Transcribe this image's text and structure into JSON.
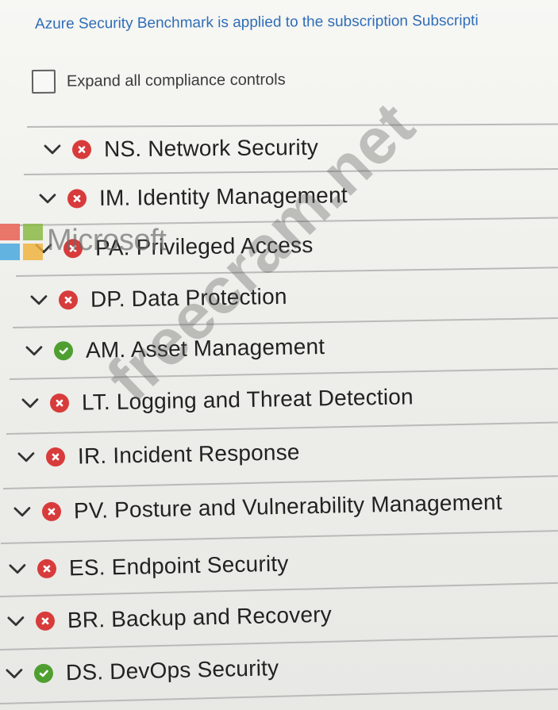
{
  "header": {
    "info_text": "Azure Security Benchmark is applied to the subscription Subscripti",
    "expand_label": "Expand all compliance controls"
  },
  "controls": [
    {
      "label": "NS. Network Security",
      "status": "failed",
      "status_icon": "error-circle-icon"
    },
    {
      "label": "IM. Identity Management",
      "status": "failed",
      "status_icon": "error-circle-icon"
    },
    {
      "label": "PA. Privileged Access",
      "status": "failed",
      "status_icon": "error-circle-icon"
    },
    {
      "label": "DP. Data Protection",
      "status": "failed",
      "status_icon": "error-circle-icon"
    },
    {
      "label": "AM. Asset Management",
      "status": "passed",
      "status_icon": "check-circle-icon"
    },
    {
      "label": "LT. Logging and Threat Detection",
      "status": "failed",
      "status_icon": "error-circle-icon"
    },
    {
      "label": "IR. Incident Response",
      "status": "failed",
      "status_icon": "error-circle-icon"
    },
    {
      "label": "PV. Posture and Vulnerability Management",
      "status": "failed",
      "status_icon": "error-circle-icon"
    },
    {
      "label": "ES. Endpoint Security",
      "status": "failed",
      "status_icon": "error-circle-icon"
    },
    {
      "label": "BR. Backup and Recovery",
      "status": "failed",
      "status_icon": "error-circle-icon"
    },
    {
      "label": "DS. DevOps Security",
      "status": "passed",
      "status_icon": "check-circle-icon"
    }
  ],
  "overlay": {
    "brand_text": "Microsoft",
    "watermark_text": "freecram.net"
  },
  "colors": {
    "link": "#2f6db7",
    "error": "#d83b3b",
    "success": "#4e9f30",
    "divider": "#b8bbb8"
  },
  "icons": {
    "chevron": "chevron-down-icon",
    "error": "error-circle-icon",
    "success": "check-circle-icon",
    "brand": "microsoft-logo-icon"
  }
}
